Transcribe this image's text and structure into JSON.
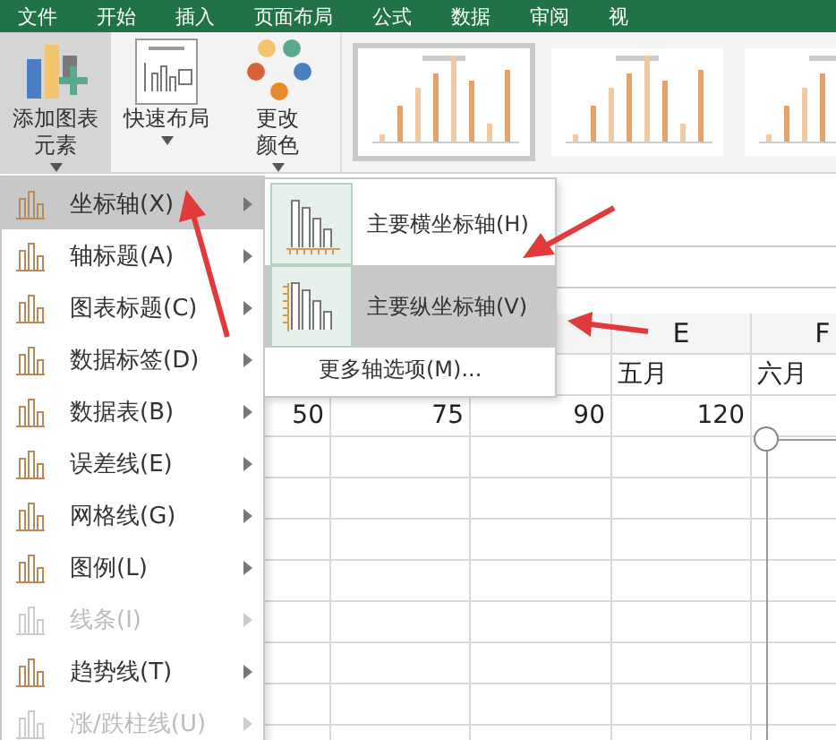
{
  "ribbon_tabs": [
    "文件",
    "开始",
    "插入",
    "页面布局",
    "公式",
    "数据",
    "审阅",
    "视"
  ],
  "ribbon_buttons": [
    {
      "kind": "elements",
      "lines": [
        "添加图表",
        "元素"
      ],
      "selected": true
    },
    {
      "kind": "layout",
      "lines": [
        "快速布局"
      ],
      "selected": false
    },
    {
      "kind": "colors",
      "lines": [
        "更改",
        "颜色"
      ],
      "selected": false
    }
  ],
  "chart_styles": [
    {
      "kind": "picture",
      "selected": true
    },
    {
      "kind": "picture",
      "selected": false
    },
    {
      "kind": "picture",
      "selected": false
    }
  ],
  "menu": {
    "items": [
      {
        "label": "坐标轴(X)",
        "selected": true,
        "disabled": false
      },
      {
        "label": "轴标题(A)",
        "selected": false,
        "disabled": false
      },
      {
        "label": "图表标题(C)",
        "selected": false,
        "disabled": false
      },
      {
        "label": "数据标签(D)",
        "selected": false,
        "disabled": false
      },
      {
        "label": "数据表(B)",
        "selected": false,
        "disabled": false
      },
      {
        "label": "误差线(E)",
        "selected": false,
        "disabled": false
      },
      {
        "label": "网格线(G)",
        "selected": false,
        "disabled": false
      },
      {
        "label": "图例(L)",
        "selected": false,
        "disabled": false
      },
      {
        "label": "线条(I)",
        "selected": false,
        "disabled": true
      },
      {
        "label": "趋势线(T)",
        "selected": false,
        "disabled": false
      },
      {
        "label": "涨/跌柱线(U)",
        "selected": false,
        "disabled": true
      }
    ]
  },
  "submenu": {
    "items": [
      {
        "label": "主要横坐标轴(H)",
        "selected": false,
        "kind": "horizontal"
      },
      {
        "label": "主要纵坐标轴(V)",
        "selected": true,
        "kind": "vertical"
      }
    ],
    "more": "更多轴选项(M)..."
  },
  "sheet": {
    "column_headers": {
      "E": "E",
      "F": "F"
    },
    "rows": [
      {
        "E": "五月",
        "F": "六月"
      },
      {
        "B": "50",
        "C": "75",
        "D": "90",
        "E": "120"
      }
    ]
  }
}
